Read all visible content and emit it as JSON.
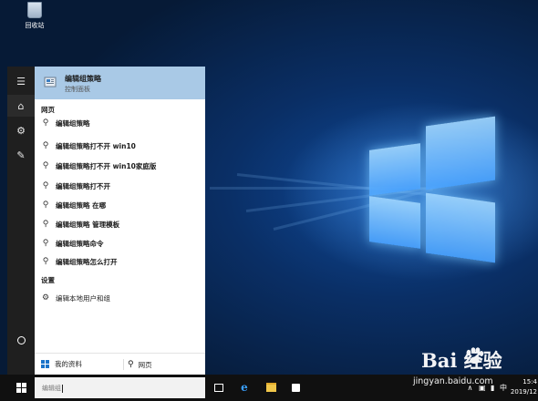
{
  "desktop": {
    "recycle_bin_label": "回收站"
  },
  "start_menu": {
    "best_match": {
      "title": "编辑组策略",
      "subtitle": "控制面板"
    },
    "sections": {
      "web": "网页",
      "settings": "设置"
    },
    "web_results": [
      "编辑组策略",
      "编辑组策略打不开 win10",
      "编辑组策略打不开 win10家庭版",
      "编辑组策略打不开",
      "编辑组策略 在哪",
      "编辑组策略 管理模板",
      "编辑组策略命令",
      "编辑组策略怎么打开"
    ],
    "settings_results": [
      "编辑本地用户和组"
    ],
    "bottom": {
      "my_stuff": "我的资料",
      "web": "网页"
    }
  },
  "taskbar": {
    "search_value": "编辑组",
    "clock_time": "15:4",
    "clock_date": "2019/12",
    "tray_ime": "中"
  },
  "watermark": {
    "brand": "Bai  经验",
    "url": "jingyan.baidu.com"
  }
}
